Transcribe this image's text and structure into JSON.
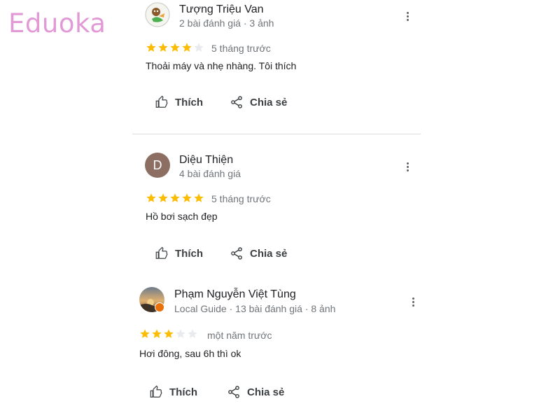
{
  "watermark": "Eduoka",
  "colors": {
    "star_filled": "#fbbc04",
    "star_empty": "#e8eaed",
    "accent": "#e29ad7",
    "local_guide_badge": "#e8710a"
  },
  "reviews": [
    {
      "author": "Tượng Triệu Van",
      "meta": "2 bài đánh giá · 3 ảnh",
      "avatar": "illustrated-avatar",
      "rating": 4,
      "rating_max": 5,
      "time": "5 tháng trước",
      "text": "Thoải máy và nhẹ nhàng. Tôi thích",
      "like_label": "Thích",
      "share_label": "Chia sẻ"
    },
    {
      "author": "Diệu Thiện",
      "meta": "4 bài đánh giá",
      "avatar_letter": "D",
      "rating": 5,
      "rating_max": 5,
      "time": "5 tháng trước",
      "text": "Hồ bơi sạch đẹp",
      "like_label": "Thích",
      "share_label": "Chia sẻ"
    },
    {
      "author": "Phạm Nguyễn Việt Tùng",
      "meta": "Local Guide · 13 bài đánh giá · 8 ảnh",
      "avatar": "photo-avatar",
      "rating": 3,
      "rating_max": 5,
      "time": "một năm trước",
      "text": "Hơi đông, sau 6h thì ok",
      "like_label": "Thích",
      "share_label": "Chia sẻ"
    }
  ]
}
